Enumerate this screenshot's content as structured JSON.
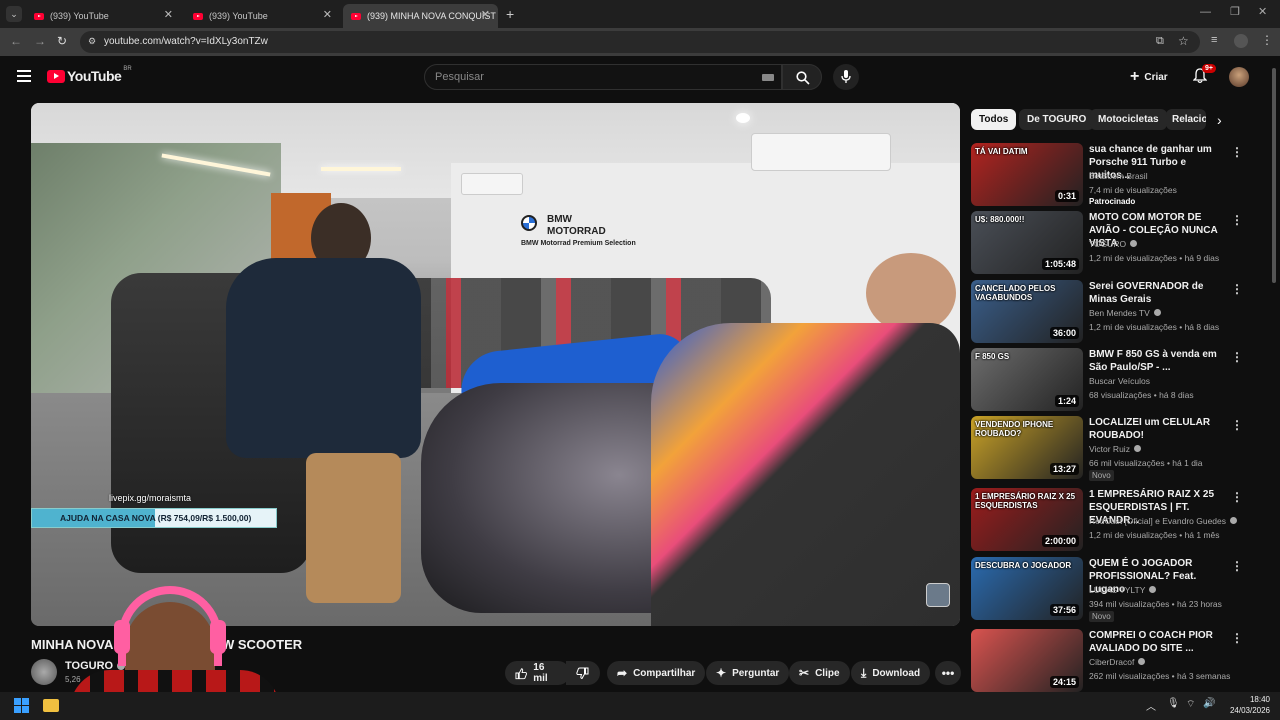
{
  "browser": {
    "tabs": [
      {
        "title": "(939) YouTube"
      },
      {
        "title": "(939) YouTube"
      },
      {
        "title": "(939) MINHA NOVA CONQUIST"
      }
    ],
    "url": "youtube.com/watch?v=IdXLy3onTZw"
  },
  "header": {
    "logo": "YouTube",
    "region": "BR",
    "search_placeholder": "Pesquisar",
    "create_label": "Criar",
    "notification_count": "9+"
  },
  "video": {
    "brand_sign_1": "BMW",
    "brand_sign_2": "MOTORRAD",
    "brand_sign_3": "BMW Motorrad Premium Selection",
    "overlay_link": "livepix.gg/moraismta",
    "overlay_goal": "AJUDA NA CASA NOVA (R$ 754,09/R$ 1.500,00)",
    "goal_progress": 0.503,
    "title": "MINHA NOVA CONQUISTA - W SCOOTER",
    "title_left": "MINHA NOVA",
    "title_right": "W SCOOTER",
    "channel": "TOGURO",
    "subscribers": "5,26"
  },
  "actions": {
    "likes": "16 mil",
    "share": "Compartilhar",
    "ask": "Perguntar",
    "clip": "Clipe",
    "download": "Download"
  },
  "chips": [
    "Todos",
    "De TOGURO",
    "Motocicletas",
    "Relacio"
  ],
  "recommendations": [
    {
      "title": "sua chance de ganhar um Porsche 911 Turbo e muitos...",
      "channel": "BetBoom Brasil",
      "meta": "7,4 mi de visualizações",
      "badge": "Patrocinado",
      "duration": "0:31",
      "thumb_text": "TÁ VAI DATIM",
      "verified": false,
      "color": "#b3231f"
    },
    {
      "title": "MOTO COM MOTOR DE AVIÃO - COLEÇÃO NUNCA VISTA",
      "channel": "TOGURO",
      "meta": "1,2 mi de visualizações • há 9 dias",
      "badge": "",
      "duration": "1:05:48",
      "thumb_text": "U$: 880.000!!",
      "verified": true,
      "color": "#4a4f57"
    },
    {
      "title": "Serei GOVERNADOR de Minas Gerais",
      "channel": "Ben Mendes TV",
      "meta": "1,2 mi de visualizações • há 8 dias",
      "badge": "",
      "duration": "36:00",
      "thumb_text": "CANCELADO PELOS VAGABUNDOS",
      "verified": true,
      "color": "#3a5f8c"
    },
    {
      "title": "BMW F 850 GS à venda em São Paulo/SP - ...",
      "channel": "Buscar Veículos",
      "meta": "68 visualizações • há 8 dias",
      "badge": "",
      "duration": "1:24",
      "thumb_text": "F 850 GS",
      "verified": false,
      "color": "#6d6d6d"
    },
    {
      "title": "LOCALIZEI um CELULAR ROUBADO!",
      "channel": "Victor Ruiz",
      "meta": "66 mil visualizações • há 1 dia",
      "badge": "Novo",
      "duration": "13:27",
      "thumb_text": "VENDENDO IPHONE ROUBADO?",
      "verified": true,
      "color": "#c9a227"
    },
    {
      "title": "1 EMPRESÁRIO RAIZ X 25 ESQUERDISTAS | FT. EVANDR...",
      "channel": "RedCast [Oficial] e Evandro Guedes",
      "meta": "1,2 mi de visualizações • há 1 mês",
      "badge": "",
      "duration": "2:00:00",
      "thumb_text": "1 EMPRESÁRIO RAIZ X 25 ESQUERDISTAS",
      "verified": true,
      "color": "#9c1c1c"
    },
    {
      "title": "QUEM É O JOGADOR PROFISSIONAL? Feat. Lugano",
      "channel": "LUCAS TYLTY",
      "meta": "394 mil visualizações • há 23 horas",
      "badge": "Novo",
      "duration": "37:56",
      "thumb_text": "DESCUBRA O JOGADOR",
      "verified": true,
      "color": "#2a6bb0"
    },
    {
      "title": "COMPREI O COACH PIOR AVALIADO DO SITE ...",
      "channel": "CiberDracof",
      "meta": "262 mil visualizações • há 3 semanas",
      "badge": "",
      "duration": "24:15",
      "thumb_text": "",
      "verified": true,
      "color": "#d9534f"
    }
  ],
  "taskbar": {
    "time": "18:40",
    "date": "24/03/2026"
  }
}
